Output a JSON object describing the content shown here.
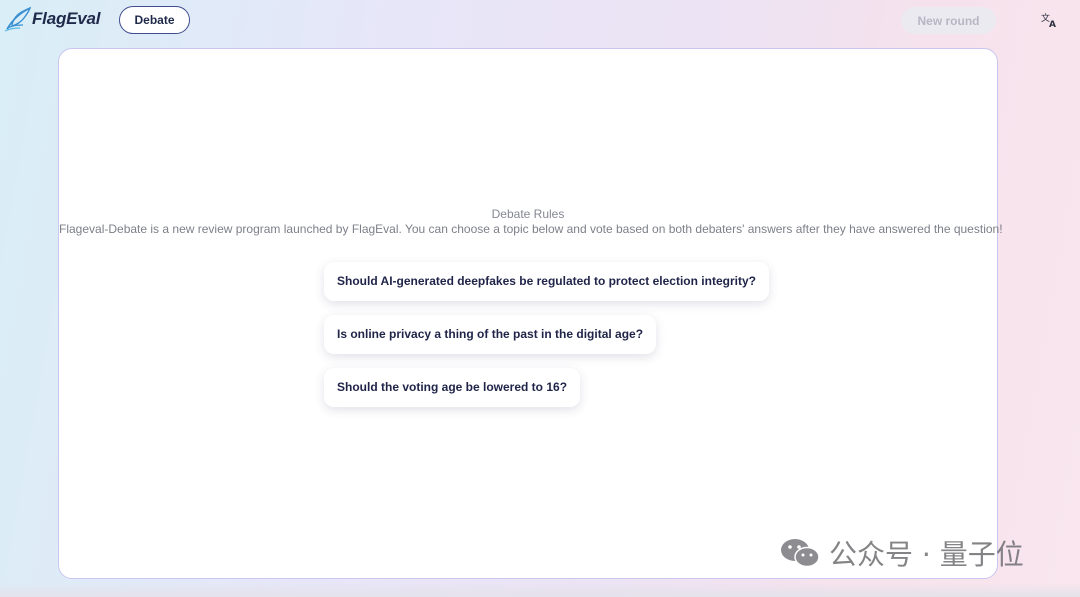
{
  "header": {
    "logo_text": "FlagEval",
    "nav_active": "Debate",
    "new_round_label": "New round"
  },
  "main": {
    "rules_title": "Debate Rules",
    "rules_description": "Flageval-Debate is a new review program launched by FlagEval. You can choose a topic below and vote based on both debaters' answers after they have answered the question!",
    "topics": [
      "Should AI-generated deepfakes be regulated to protect election integrity?",
      "Is online privacy a thing of the past in the digital age?",
      "Should the voting age be lowered to 16?"
    ]
  },
  "watermark": {
    "text": "公众号 · 量子位"
  },
  "icons": {
    "logo": "flageval-feather-logo",
    "translate": "translate-icon",
    "watermark": "wechat-icon"
  },
  "colors": {
    "nav_border": "#3f4c8f",
    "text_dark": "#1f2448",
    "panel_border": "#c9c6ef",
    "button_disabled_bg": "#eceaf1",
    "button_disabled_text": "#b8b6c3"
  }
}
